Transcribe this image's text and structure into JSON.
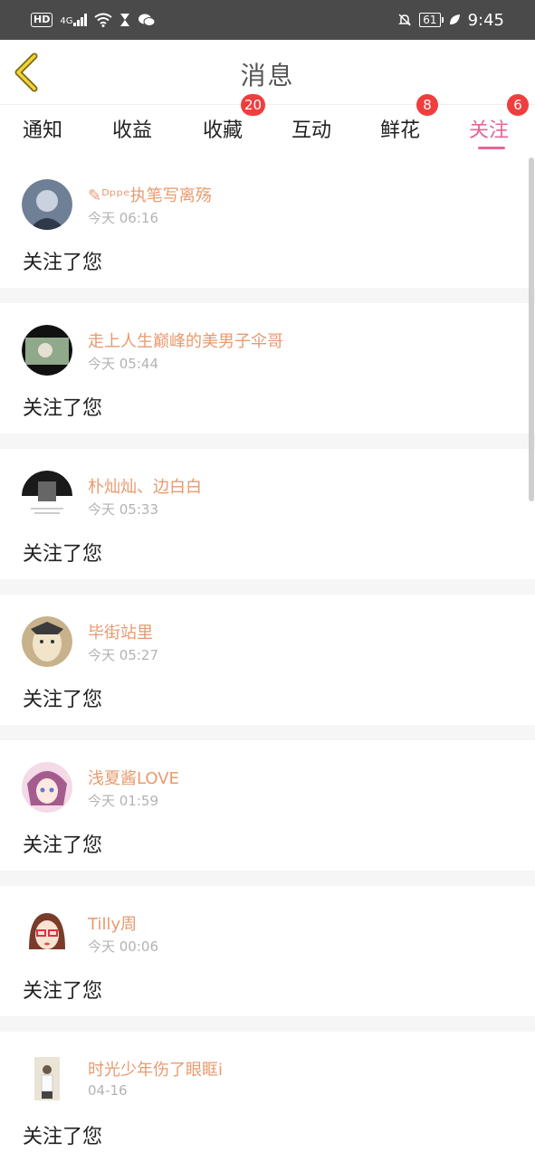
{
  "status_bar": {
    "network": "HD",
    "signal_type": "4G",
    "battery": "61",
    "time": "9:45",
    "icons": [
      "hd-icon",
      "signal-icon",
      "wifi-icon",
      "hourglass-icon",
      "wechat-icon",
      "bell-off-icon",
      "battery-icon",
      "leaf-icon"
    ]
  },
  "header": {
    "title": "消息",
    "back_icon": "chevron-left-icon"
  },
  "tabs": [
    {
      "label": "通知",
      "badge": ""
    },
    {
      "label": "收益",
      "badge": ""
    },
    {
      "label": "收藏",
      "badge": "20"
    },
    {
      "label": "互动",
      "badge": ""
    },
    {
      "label": "鲜花",
      "badge": "8"
    },
    {
      "label": "关注",
      "badge": "6",
      "active": true
    }
  ],
  "follows": [
    {
      "name": "✎ᴰᵖᵖᵉ执笔写离殇",
      "time": "今天 06:16",
      "message": "关注了您",
      "avatar_color": "#6f7f95"
    },
    {
      "name": "走上人生巅峰的美男子伞哥",
      "time": "今天 05:44",
      "message": "关注了您",
      "avatar_color": "#6f8f6a"
    },
    {
      "name": "朴灿灿、边白白",
      "time": "今天 05:33",
      "message": "关注了您",
      "avatar_color": "#2b2b2b"
    },
    {
      "name": "毕街站里",
      "time": "今天 05:27",
      "message": "关注了您",
      "avatar_color": "#c7b28c"
    },
    {
      "name": "浅夏酱LOVE",
      "time": "今天 01:59",
      "message": "关注了您",
      "avatar_color": "#a45c8f"
    },
    {
      "name": "Tilly周",
      "time": "今天 00:06",
      "message": "关注了您",
      "avatar_color": "#7a3b2b"
    },
    {
      "name": "时光少年伤了眼眶i",
      "time": "04-16",
      "message": "关注了您",
      "avatar_color": "#d6d0c2"
    }
  ],
  "colors": {
    "accent": "#e8659a",
    "name": "#e89a6f",
    "badge": "#f03e3e"
  }
}
